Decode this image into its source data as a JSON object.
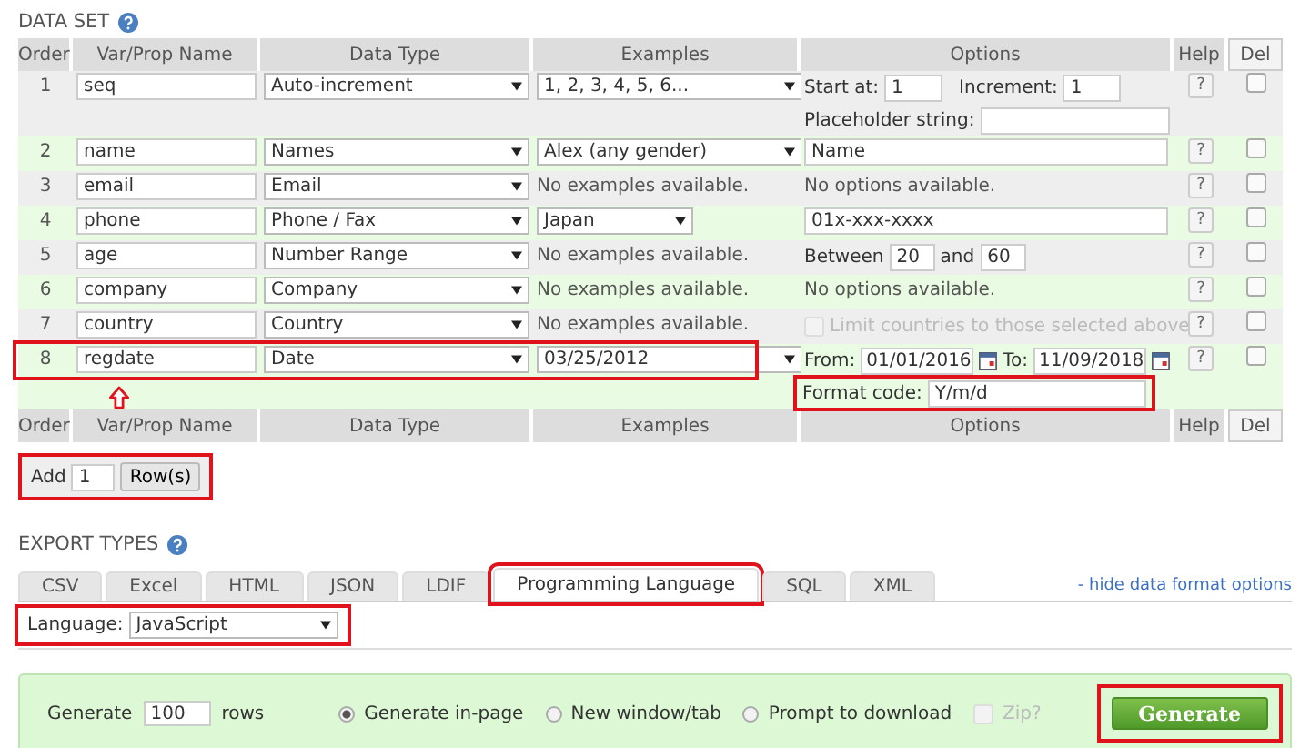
{
  "data_set": {
    "title": "DATA SET",
    "columns": [
      "Order",
      "Var/Prop Name",
      "Data Type",
      "Examples",
      "Options",
      "Help",
      "Del"
    ],
    "rows": [
      {
        "order": "1",
        "name": "seq",
        "type": "Auto-increment",
        "example": {
          "kind": "select",
          "value": "1, 2, 3, 4, 5, 6..."
        },
        "options": {
          "kind": "increment",
          "start_label": "Start at:",
          "start": "1",
          "increment_label": "Increment:",
          "increment": "1",
          "placeholder_label": "Placeholder string:"
        },
        "help": "?",
        "delete_checked": false,
        "highlighted": false,
        "pointer_arrow": false
      },
      {
        "order": "2",
        "name": "name",
        "type": "Names",
        "example": {
          "kind": "select",
          "value": "Alex (any gender)"
        },
        "options": {
          "kind": "text",
          "value": "Name"
        },
        "help": "?",
        "delete_checked": false,
        "highlighted": false,
        "pointer_arrow": false
      },
      {
        "order": "3",
        "name": "email",
        "type": "Email",
        "example": {
          "kind": "note",
          "value": "No examples available."
        },
        "options": {
          "kind": "note",
          "value": "No options available."
        },
        "help": "?",
        "delete_checked": false,
        "highlighted": false,
        "pointer_arrow": false
      },
      {
        "order": "4",
        "name": "phone",
        "type": "Phone / Fax",
        "example": {
          "kind": "select",
          "value": "Japan"
        },
        "options": {
          "kind": "text",
          "value": "01x-xxx-xxxx"
        },
        "help": "?",
        "delete_checked": false,
        "highlighted": false,
        "pointer_arrow": false
      },
      {
        "order": "5",
        "name": "age",
        "type": "Number Range",
        "example": {
          "kind": "note",
          "value": "No examples available."
        },
        "options": {
          "kind": "range",
          "label": "Between",
          "min": "20",
          "and_label": "and",
          "max": "60"
        },
        "help": "?",
        "delete_checked": false,
        "highlighted": false,
        "pointer_arrow": false
      },
      {
        "order": "6",
        "name": "company",
        "type": "Company",
        "example": {
          "kind": "note",
          "value": "No examples available."
        },
        "options": {
          "kind": "note",
          "value": "No options available."
        },
        "help": "?",
        "delete_checked": false,
        "highlighted": false,
        "pointer_arrow": false
      },
      {
        "order": "7",
        "name": "country",
        "type": "Country",
        "example": {
          "kind": "note",
          "value": "No examples available."
        },
        "options": {
          "kind": "checkbox",
          "label": "Limit countries to those selected above",
          "checked": false,
          "disabled": true
        },
        "help": "?",
        "delete_checked": false,
        "highlighted": false,
        "pointer_arrow": false
      },
      {
        "order": "8",
        "name": "regdate",
        "type": "Date",
        "example": {
          "kind": "select",
          "value": "03/25/2012"
        },
        "options": {
          "kind": "date",
          "from_label": "From:",
          "from": "01/01/2016",
          "to_label": "To:",
          "to": "11/09/2018",
          "format_label": "Format code:",
          "format": "Y/m/d",
          "format_highlighted": true
        },
        "help": "?",
        "delete_checked": false,
        "highlighted": true,
        "pointer_arrow": true
      }
    ],
    "footer_columns": [
      "Order",
      "Var/Prop Name",
      "Data Type",
      "Examples",
      "Options",
      "Help",
      "Del"
    ]
  },
  "add_rows": {
    "label": "Add",
    "count": "1",
    "button": "Row(s)",
    "highlighted": true
  },
  "export_types": {
    "title": "EXPORT TYPES",
    "tabs": [
      {
        "label": "CSV",
        "selected": false,
        "highlighted": false
      },
      {
        "label": "Excel",
        "selected": false,
        "highlighted": false
      },
      {
        "label": "HTML",
        "selected": false,
        "highlighted": false
      },
      {
        "label": "JSON",
        "selected": false,
        "highlighted": false
      },
      {
        "label": "LDIF",
        "selected": false,
        "highlighted": false
      },
      {
        "label": "Programming Language",
        "selected": true,
        "highlighted": true
      },
      {
        "label": "SQL",
        "selected": false,
        "highlighted": false
      },
      {
        "label": "XML",
        "selected": false,
        "highlighted": false
      }
    ],
    "hide_link": "- hide data format options",
    "language": {
      "label": "Language:",
      "value": "JavaScript",
      "highlighted": true
    }
  },
  "generate": {
    "label": "Generate",
    "count": "100",
    "unit": "rows",
    "radios": [
      {
        "label": "Generate in-page",
        "selected": true
      },
      {
        "label": "New window/tab",
        "selected": false
      },
      {
        "label": "Prompt to download",
        "selected": false
      }
    ],
    "zip": {
      "label": "Zip?",
      "checked": false,
      "disabled": true
    },
    "button": "Generate",
    "button_highlighted": true
  }
}
